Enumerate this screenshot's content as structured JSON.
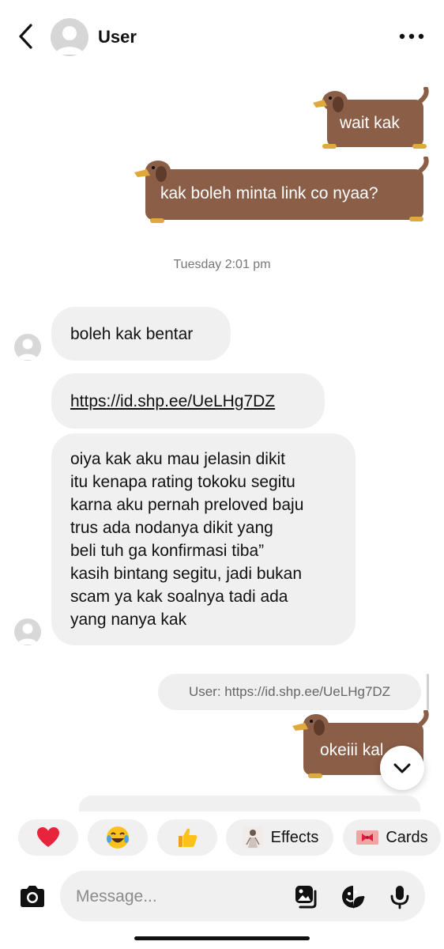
{
  "header": {
    "title": "User",
    "back_icon": "chevron-left-icon",
    "more_icon": "more-horizontal-icon"
  },
  "messages": {
    "sent_1": "wait kak",
    "sent_2": "kak boleh minta link co nyaa?",
    "timestamp": "Tuesday 2:01 pm",
    "received_1": "boleh kak bentar",
    "received_2": "https://id.shp.ee/UeLHg7DZ",
    "received_3_lines": [
      "oiya kak aku mau jelasin dikit",
      "itu kenapa rating tokoku segitu",
      "karna aku pernah preloved baju",
      "trus ada nodanya dikit yang",
      "beli tuh ga konfirmasi tiba”",
      "kasih bintang segitu, jadi bukan",
      "scam ya kak soalnya tadi ada",
      "yang nanya kak"
    ],
    "reply_preview": "User: https://id.shp.ee/UeLHg7DZ",
    "sent_3": "okeiii kak!"
  },
  "reactions": {
    "heart": "❤️",
    "laugh": "😂",
    "thumbs_up": "👍",
    "effects_label": "Effects",
    "cards_label": "Cards"
  },
  "composer": {
    "placeholder": "Message...",
    "icons": [
      "camera-icon",
      "gallery-icon",
      "sticker-icon",
      "microphone-icon"
    ]
  },
  "colors": {
    "dog_body": "#8b5e47",
    "bubble_gray": "#f0f0f0",
    "heart_red": "#e8243c"
  }
}
